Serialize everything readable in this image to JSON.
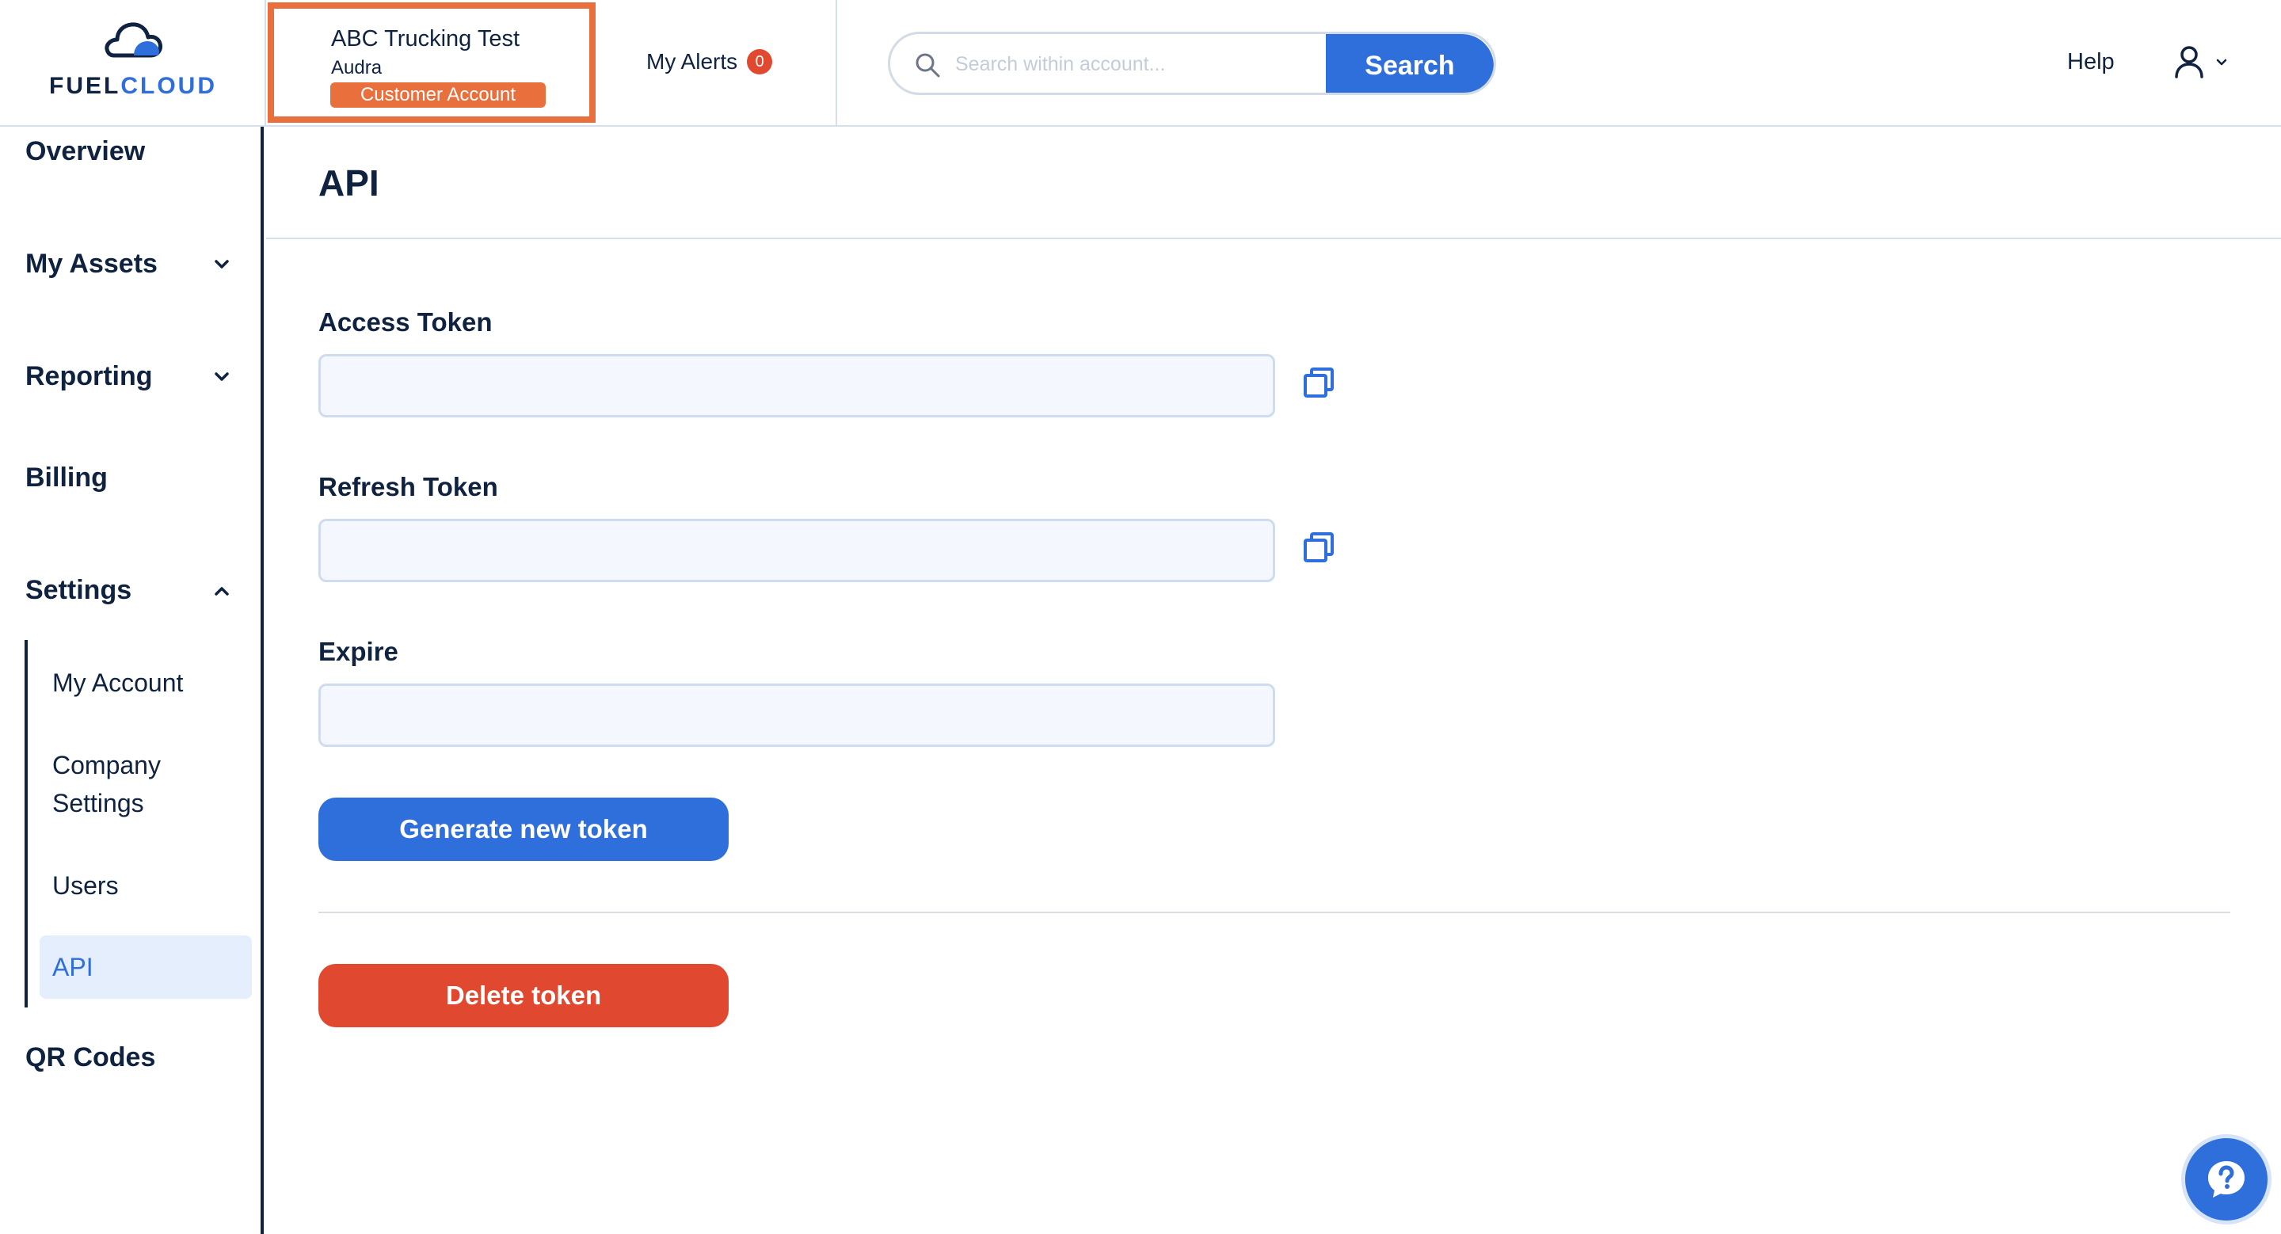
{
  "brand": {
    "fuel": "FUEL",
    "cloud": "CLOUD"
  },
  "account": {
    "name": "ABC Trucking Test",
    "user": "Audra",
    "badge": "Customer Account"
  },
  "alerts": {
    "label": "My Alerts",
    "count": "0"
  },
  "search": {
    "placeholder": "Search within account...",
    "button_label": "Search"
  },
  "header": {
    "help_label": "Help"
  },
  "sidebar": {
    "items": [
      {
        "label": "Overview"
      },
      {
        "label": "My Assets"
      },
      {
        "label": "Reporting"
      },
      {
        "label": "Billing"
      },
      {
        "label": "Settings"
      },
      {
        "label": "QR Codes"
      }
    ],
    "settings_sub": [
      {
        "label": "My Account"
      },
      {
        "label": "Company Settings"
      },
      {
        "label": "Users"
      },
      {
        "label": "API"
      }
    ]
  },
  "page": {
    "title": "API"
  },
  "fields": {
    "access_token": {
      "label": "Access Token",
      "value": ""
    },
    "refresh_token": {
      "label": "Refresh Token",
      "value": ""
    },
    "expire": {
      "label": "Expire",
      "value": ""
    }
  },
  "actions": {
    "generate_label": "Generate new token",
    "delete_label": "Delete token"
  },
  "colors": {
    "brand_blue": "#2f6fdb",
    "navy": "#0f2240",
    "account_orange": "#e96f3d",
    "danger_red": "#e0492f"
  }
}
